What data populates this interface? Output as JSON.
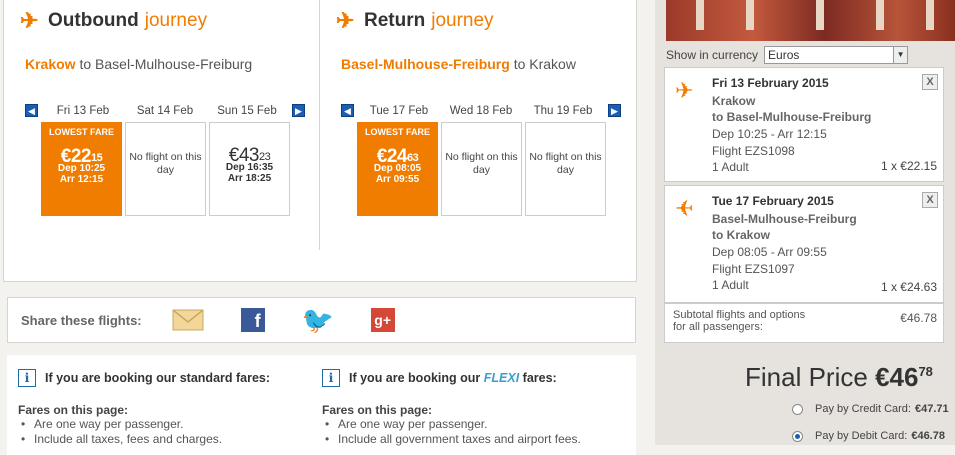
{
  "outbound": {
    "title": "Outbound",
    "title_accent": "journey",
    "route_from": "Krakow",
    "route_to": "to Basel-Mulhouse-Freiburg",
    "days": [
      "Fri 13 Feb",
      "Sat 14 Feb",
      "Sun 15 Feb"
    ],
    "cards": [
      {
        "badge": "LOWEST FARE",
        "price_main": "€22",
        "price_cents": "15",
        "dep": "Dep 10:25",
        "arr": "Arr 12:15"
      },
      {
        "no_flight": "No flight on this day"
      },
      {
        "price_main": "€43",
        "price_cents": "23",
        "dep": "Dep 16:35",
        "arr": "Arr 18:25"
      }
    ]
  },
  "return": {
    "title": "Return",
    "title_accent": "journey",
    "route_from": "Basel-Mulhouse-Freiburg",
    "route_to": "to Krakow",
    "days": [
      "Tue 17 Feb",
      "Wed 18 Feb",
      "Thu 19 Feb"
    ],
    "cards": [
      {
        "badge": "LOWEST FARE",
        "price_main": "€24",
        "price_cents": "63",
        "dep": "Dep 08:05",
        "arr": "Arr 09:55"
      },
      {
        "no_flight": "No flight on this day"
      },
      {
        "no_flight": "No flight on this day"
      }
    ]
  },
  "share": {
    "label": "Share these flights:",
    "icons": [
      "email-icon",
      "facebook-icon",
      "twitter-icon",
      "google-plus-icon"
    ]
  },
  "info": {
    "standard": {
      "prefix": "If you are booking our standard fares:",
      "fares_label": "Fares on this page:",
      "bullets": [
        "Are one way per passenger.",
        "Include all taxes, fees and charges."
      ]
    },
    "flexi": {
      "prefix": "If you are booking our",
      "flexi": "FLEXI",
      "suffix": "fares:",
      "fares_label": "Fares on this page:",
      "bullets": [
        "Are one way per passenger.",
        "Include all government taxes and airport fees."
      ]
    }
  },
  "sidebar": {
    "currency_label": "Show in currency",
    "currency_value": "Euros",
    "segments": [
      {
        "date": "Fri 13 February 2015",
        "from": "Krakow",
        "to": "to Basel-Mulhouse-Freiburg",
        "times": "Dep 10:25 - Arr 12:15",
        "flight": "Flight EZS1098",
        "pax": "1 Adult",
        "qty": "1 x €22.15"
      },
      {
        "date": "Tue 17 February 2015",
        "from": "Basel-Mulhouse-Freiburg",
        "to": "to Krakow",
        "times": "Dep 08:05 - Arr 09:55",
        "flight": "Flight EZS1097",
        "pax": "1 Adult",
        "qty": "1 x €24.63"
      }
    ],
    "subtotal_label1": "Subtotal flights and options",
    "subtotal_label2": "for all passengers:",
    "subtotal_amount": "€46.78",
    "final_label": "Final Price",
    "final_main": "€46",
    "final_cents": "78",
    "pay_credit_label": "Pay by Credit Card:",
    "pay_credit_amount": "€47.71",
    "pay_debit_label": "Pay by Debit Card:",
    "pay_debit_amount": "€46.78"
  },
  "colors": {
    "accent": "#f07c00",
    "link_blue": "#1a5fb4"
  }
}
